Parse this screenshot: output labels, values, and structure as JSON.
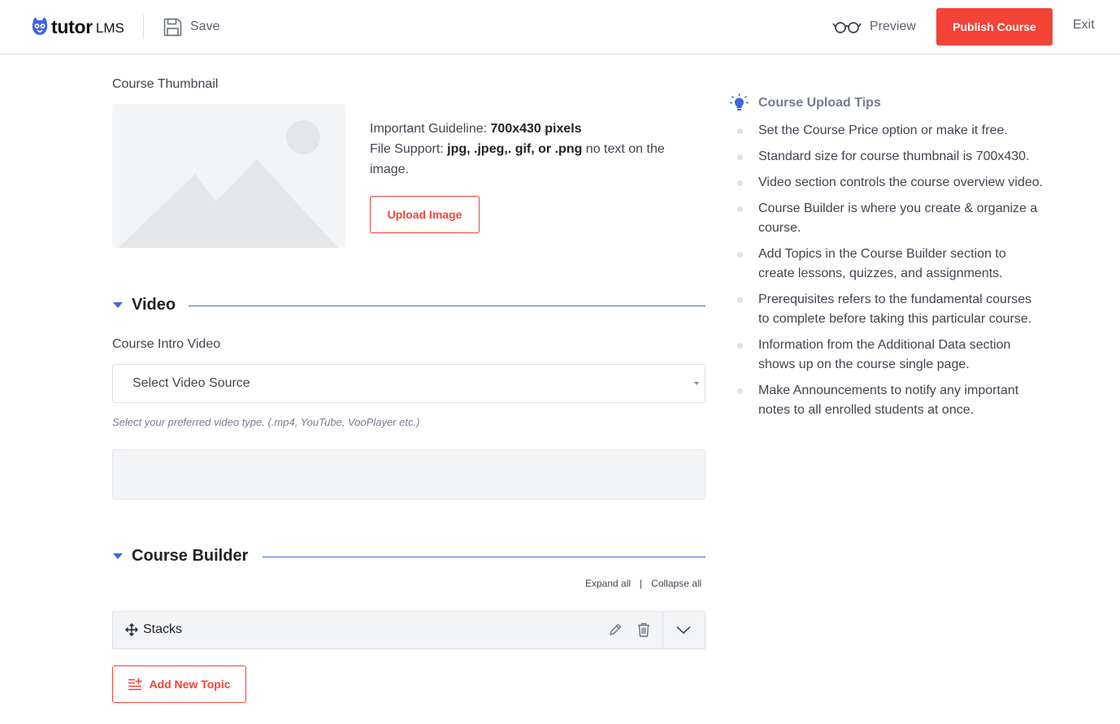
{
  "header": {
    "logo_text": "tutor",
    "logo_suffix": "LMS",
    "save_label": "Save",
    "preview_label": "Preview",
    "publish_label": "Publish Course",
    "exit_label": "Exit"
  },
  "thumbnail": {
    "label": "Course Thumbnail",
    "guideline_prefix": "Important Guideline: ",
    "guideline_size": "700x430 pixels",
    "support_prefix": "File Support: ",
    "support_types": "jpg, .jpeg,. gif, or .png",
    "support_suffix": " no text on the image.",
    "upload_label": "Upload Image"
  },
  "video": {
    "section_title": "Video",
    "field_label": "Course Intro Video",
    "select_value": "Select Video Source",
    "hint": "Select your preferred video type. (.mp4, YouTube, VooPlayer etc.)"
  },
  "builder": {
    "section_title": "Course Builder",
    "expand_all": "Expand all",
    "separator": "|",
    "collapse_all": "Collapse all",
    "topics": [
      {
        "name": "Stacks"
      }
    ],
    "add_topic_label": "Add New Topic"
  },
  "tips": {
    "title": "Course Upload Tips",
    "items": [
      "Set the Course Price option or make it free.",
      "Standard size for course thumbnail is 700x430.",
      "Video section controls the course overview video.",
      "Course Builder is where you create & organize a course.",
      "Add Topics in the Course Builder section to create lessons, quizzes, and assignments.",
      "Prerequisites refers to the fundamental courses to complete before taking this particular course.",
      "Information from the Additional Data section shows up on the course single page.",
      "Make Announcements to notify any important notes to all enrolled students at once."
    ]
  },
  "colors": {
    "accent": "#f44337",
    "section_blue": "#3e64de",
    "text": "#41454f",
    "muted": "#757c8e"
  },
  "icons": {
    "logo": "tutor-owl-icon",
    "save": "floppy-disk-icon",
    "preview": "glasses-icon",
    "tips": "lightbulb-icon",
    "move": "move-arrows-icon",
    "edit": "pencil-icon",
    "delete": "trash-icon",
    "toggle": "chevron-down-icon",
    "add_topic": "add-list-icon"
  }
}
